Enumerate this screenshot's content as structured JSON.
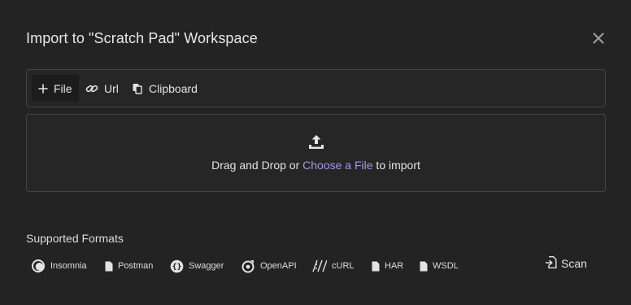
{
  "title": "Import to \"Scratch Pad\" Workspace",
  "tabs": [
    {
      "label": "File",
      "icon": "plus-icon",
      "active": true
    },
    {
      "label": "Url",
      "icon": "link-icon"
    },
    {
      "label": "Clipboard",
      "icon": "clipboard-icon"
    }
  ],
  "dropzone": {
    "text_before": "Drag and Drop or ",
    "link": "Choose a File",
    "text_after": " to import"
  },
  "formats": {
    "label": "Supported Formats",
    "items": [
      {
        "label": "Insomnia",
        "icon": "insomnia-icon"
      },
      {
        "label": "Postman",
        "icon": "file-icon"
      },
      {
        "label": "Swagger",
        "icon": "swagger-icon"
      },
      {
        "label": "OpenAPI",
        "icon": "openapi-icon"
      },
      {
        "label": "cURL",
        "icon": "curl-icon"
      },
      {
        "label": "HAR",
        "icon": "file-icon"
      },
      {
        "label": "WSDL",
        "icon": "file-icon"
      }
    ]
  },
  "scan": {
    "label": "Scan",
    "icon": "file-import-icon"
  },
  "colors": {
    "background": "#232323",
    "link": "#a996e8",
    "border": "#444444"
  }
}
